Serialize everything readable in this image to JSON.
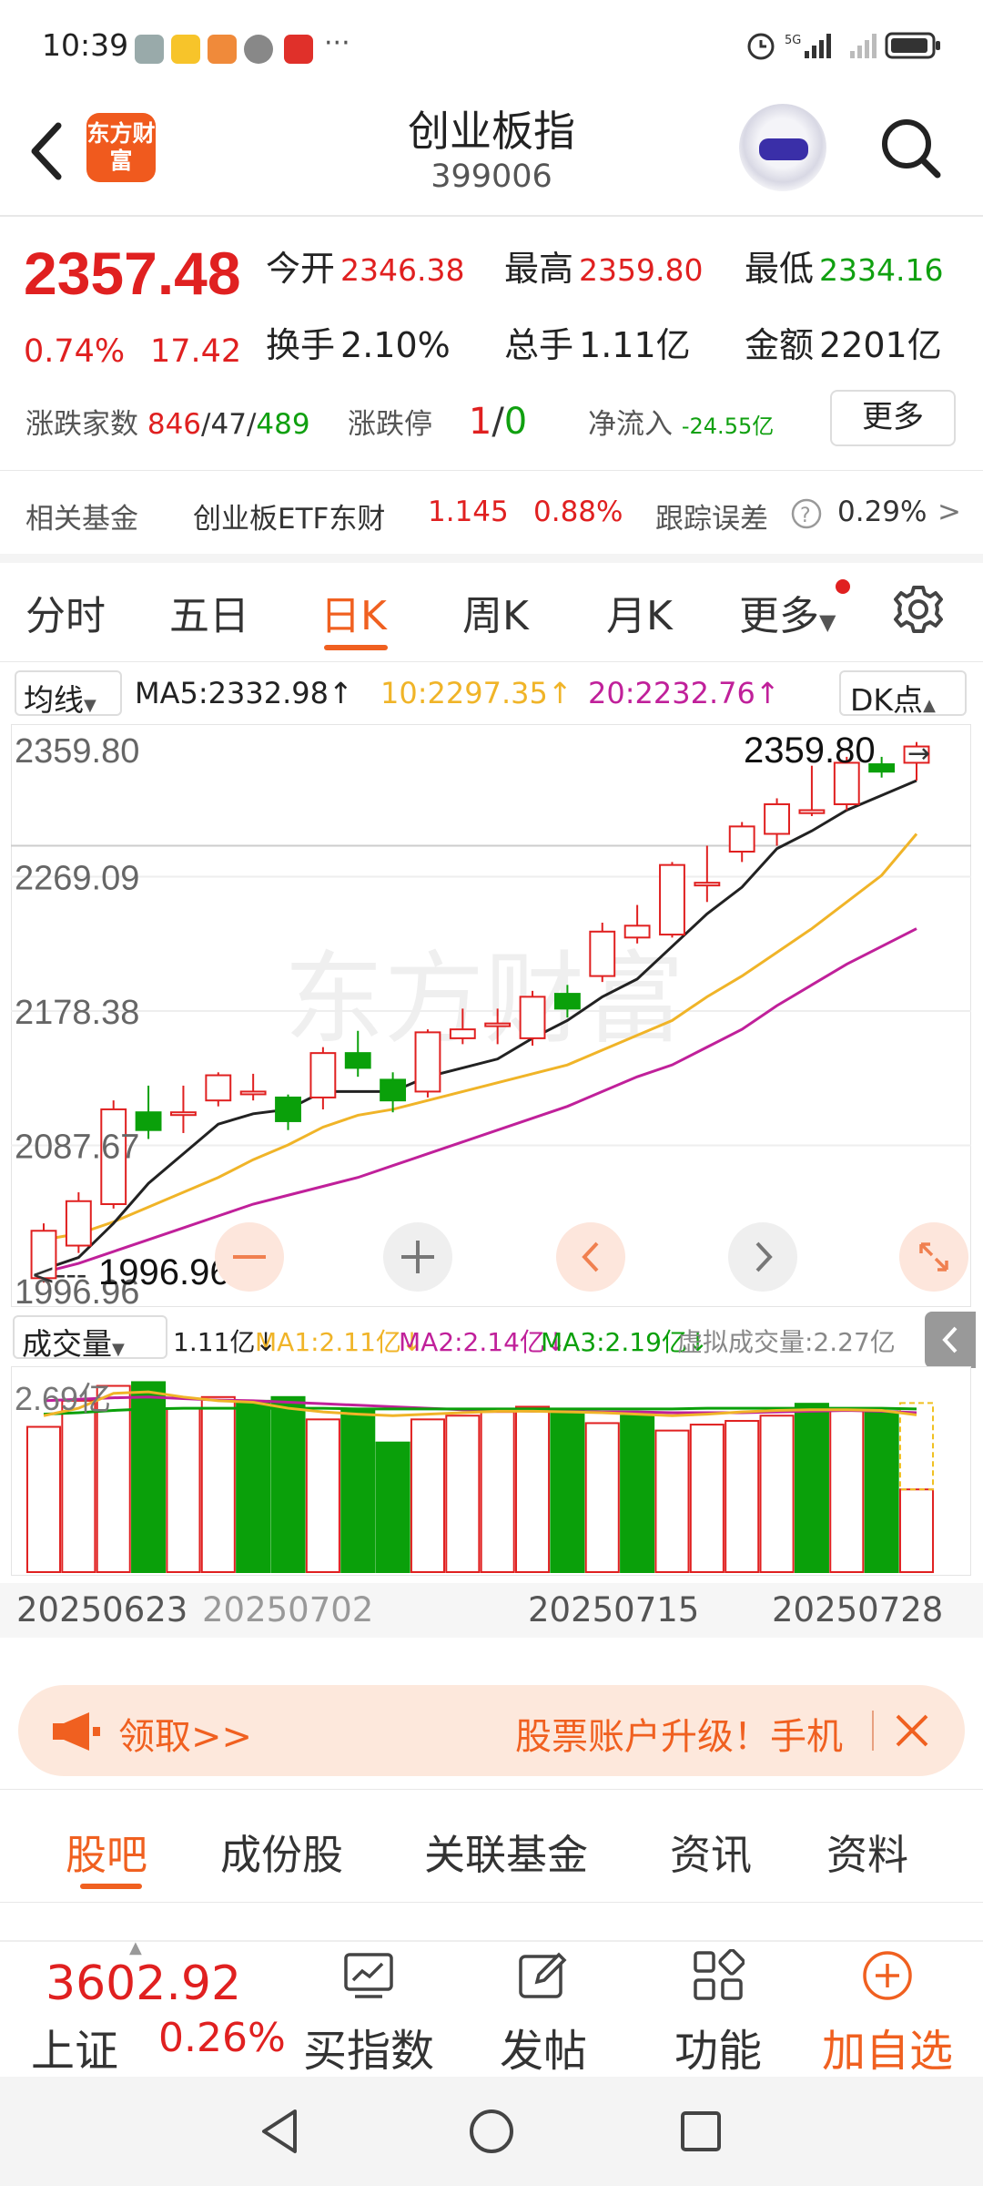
{
  "status_bar": {
    "time": "10:39",
    "more": "···"
  },
  "header": {
    "logo_text": "东方财富",
    "title": "创业板指",
    "code": "399006"
  },
  "quote": {
    "price": "2357.48",
    "change_pct": "0.74%",
    "change": "17.42",
    "open_label": "今开",
    "open": "2346.38",
    "high_label": "最高",
    "high": "2359.80",
    "low_label": "最低",
    "low": "2334.16",
    "turnover_label": "换手",
    "turnover": "2.10%",
    "volume_label": "总手",
    "volume": "1.11亿",
    "amount_label": "金额",
    "amount": "2201亿",
    "breadth_label": "涨跌家数",
    "breadth_up": "846",
    "breadth_flat": "47",
    "breadth_down": "489",
    "limit_label": "涨跌停",
    "limit_up": "1",
    "limit_down": "0",
    "netflow_label": "净流入",
    "netflow": "-24.55亿",
    "more_button": "更多"
  },
  "fund": {
    "label": "相关基金",
    "name": "创业板ETF东财",
    "price": "1.145",
    "pct": "0.88%",
    "err_label": "跟踪误差",
    "err": "0.29%",
    "arrow": ">"
  },
  "kline_tabs": [
    "分时",
    "五日",
    "日K",
    "周K",
    "月K",
    "更多"
  ],
  "ma": {
    "selector": "均线",
    "ma5": "MA5:2332.98↑",
    "ma10": "10:2297.35↑",
    "ma20": "20:2232.76↑",
    "dk": "DK点"
  },
  "chart_data": {
    "type": "candlestick",
    "axis_labels": [
      "2359.80",
      "2269.09",
      "2178.38",
      "2087.67",
      "1996.96"
    ],
    "high_marker": "2359.80",
    "low_marker": "1996.96",
    "ylim": [
      1996.96,
      2359.8
    ],
    "dates": [
      "20250623",
      "20250702",
      "20250715",
      "20250728"
    ],
    "colors": {
      "up": "#e02020",
      "down": "#0aa00a",
      "ma5": "#222222",
      "ma10": "#f0b428",
      "ma20": "#c0209a"
    },
    "candles": [
      {
        "o": 1998,
        "c": 2030,
        "h": 2035,
        "l": 1995
      },
      {
        "o": 2020,
        "c": 2050,
        "h": 2056,
        "l": 2015
      },
      {
        "o": 2048,
        "c": 2112,
        "h": 2118,
        "l": 2045
      },
      {
        "o": 2110,
        "c": 2098,
        "h": 2128,
        "l": 2092
      },
      {
        "o": 2110,
        "c": 2110,
        "h": 2128,
        "l": 2096
      },
      {
        "o": 2118,
        "c": 2135,
        "h": 2137,
        "l": 2114
      },
      {
        "o": 2124,
        "c": 2124,
        "h": 2136,
        "l": 2118
      },
      {
        "o": 2120,
        "c": 2104,
        "h": 2122,
        "l": 2098
      },
      {
        "o": 2120,
        "c": 2150,
        "h": 2154,
        "l": 2112
      },
      {
        "o": 2150,
        "c": 2140,
        "h": 2165,
        "l": 2134
      },
      {
        "o": 2132,
        "c": 2118,
        "h": 2137,
        "l": 2110
      },
      {
        "o": 2124,
        "c": 2164,
        "h": 2166,
        "l": 2120
      },
      {
        "o": 2160,
        "c": 2166,
        "h": 2180,
        "l": 2156
      },
      {
        "o": 2170,
        "c": 2170,
        "h": 2180,
        "l": 2156
      },
      {
        "o": 2160,
        "c": 2188,
        "h": 2192,
        "l": 2155
      },
      {
        "o": 2190,
        "c": 2180,
        "h": 2196,
        "l": 2174
      },
      {
        "o": 2202,
        "c": 2232,
        "h": 2238,
        "l": 2198
      },
      {
        "o": 2228,
        "c": 2236,
        "h": 2250,
        "l": 2224
      },
      {
        "o": 2230,
        "c": 2277,
        "h": 2279,
        "l": 2228
      },
      {
        "o": 2265,
        "c": 2265,
        "h": 2290,
        "l": 2252
      },
      {
        "o": 2286,
        "c": 2303,
        "h": 2306,
        "l": 2279
      },
      {
        "o": 2298,
        "c": 2318,
        "h": 2322,
        "l": 2290
      },
      {
        "o": 2312,
        "c": 2314,
        "h": 2344,
        "l": 2310
      },
      {
        "o": 2318,
        "c": 2346,
        "h": 2350,
        "l": 2314
      },
      {
        "o": 2345,
        "c": 2340,
        "h": 2350,
        "l": 2336
      },
      {
        "o": 2346,
        "c": 2357,
        "h": 2360,
        "l": 2334
      }
    ],
    "ma5": [
      2004,
      2012,
      2035,
      2062,
      2082,
      2102,
      2109,
      2112,
      2124,
      2124,
      2124,
      2134,
      2140,
      2146,
      2160,
      2172,
      2188,
      2200,
      2222,
      2244,
      2262,
      2288,
      2300,
      2314,
      2324,
      2334
    ],
    "ma10": [
      2024,
      2028,
      2036,
      2046,
      2056,
      2066,
      2078,
      2088,
      2100,
      2108,
      2112,
      2118,
      2124,
      2130,
      2136,
      2142,
      2152,
      2162,
      2172,
      2188,
      2202,
      2218,
      2234,
      2252,
      2270,
      2298
    ],
    "ma20": [
      2002,
      2008,
      2016,
      2024,
      2032,
      2040,
      2048,
      2054,
      2060,
      2066,
      2074,
      2082,
      2090,
      2098,
      2106,
      2114,
      2124,
      2134,
      2142,
      2154,
      2166,
      2182,
      2196,
      2210,
      2222,
      2234
    ]
  },
  "volume": {
    "selector": "成交量",
    "vol": "1.11亿↓",
    "ma1": "MA1:2.11亿↓",
    "ma2": "MA2:2.14亿↓",
    "ma3": "MA3:2.19亿↓",
    "virtual": "虚拟成交量:2.27亿",
    "axis_label": "2.69亿",
    "bars": [
      1.95,
      2.3,
      2.5,
      2.55,
      2.2,
      2.35,
      2.3,
      2.35,
      2.05,
      2.17,
      1.74,
      2.05,
      2.1,
      2.15,
      2.22,
      2.18,
      2.0,
      2.1,
      1.9,
      1.98,
      2.03,
      2.1,
      2.26,
      2.2,
      2.16,
      1.11
    ],
    "up": [
      true,
      true,
      true,
      false,
      true,
      true,
      false,
      false,
      true,
      false,
      false,
      true,
      true,
      true,
      true,
      false,
      true,
      false,
      true,
      true,
      true,
      true,
      false,
      true,
      false,
      true
    ]
  },
  "banner": {
    "left_text": "领取>>",
    "right_text": "股票账户升级！手机"
  },
  "bottom_tabs": [
    "股吧",
    "成份股",
    "关联基金",
    "资讯",
    "资料"
  ],
  "toolbar": {
    "index_price": "3602.92",
    "index_name": "上证",
    "index_pct": "0.26%",
    "buy_index": "买指数",
    "post": "发帖",
    "functions": "功能",
    "add_watch": "加自选"
  }
}
